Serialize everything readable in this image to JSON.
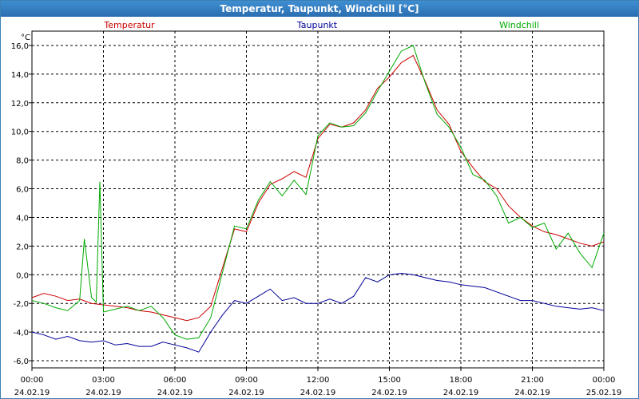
{
  "window": {
    "title": "Temperatur, Taupunkt, Windchill [°C]"
  },
  "chart_data": {
    "type": "line",
    "title": "Temperatur, Taupunkt, Windchill [°C]",
    "ylabel": "°C",
    "xlabel": "",
    "ylim": [
      -6.5,
      17.0
    ],
    "xlim": [
      0,
      24
    ],
    "grid": true,
    "legend_position": "top",
    "y_ticks": [
      "16,0",
      "14,0",
      "12,0",
      "10,0",
      "8,0",
      "6,0",
      "4,0",
      "2,0",
      "0,0",
      "-2,0",
      "-4,0",
      "-6,0"
    ],
    "x_ticks": [
      {
        "time": "00:00",
        "date": "24.02.19"
      },
      {
        "time": "03:00",
        "date": "24.02.19"
      },
      {
        "time": "06:00",
        "date": "24.02.19"
      },
      {
        "time": "09:00",
        "date": "24.02.19"
      },
      {
        "time": "12:00",
        "date": "24.02.19"
      },
      {
        "time": "15:00",
        "date": "24.02.19"
      },
      {
        "time": "18:00",
        "date": "24.02.19"
      },
      {
        "time": "21:00",
        "date": "24.02.19"
      },
      {
        "time": "00:00",
        "date": "25.02.19"
      }
    ],
    "series": [
      {
        "name": "Temperatur",
        "color": "#cc0000",
        "points": [
          [
            0,
            -1.6
          ],
          [
            0.5,
            -1.3
          ],
          [
            1,
            -1.5
          ],
          [
            1.5,
            -1.8
          ],
          [
            2,
            -1.7
          ],
          [
            2.5,
            -2.0
          ],
          [
            3,
            -2.1
          ],
          [
            3.5,
            -2.2
          ],
          [
            4,
            -2.3
          ],
          [
            4.5,
            -2.5
          ],
          [
            5,
            -2.6
          ],
          [
            5.5,
            -2.8
          ],
          [
            6,
            -3.0
          ],
          [
            6.5,
            -3.2
          ],
          [
            7,
            -3.0
          ],
          [
            7.5,
            -2.2
          ],
          [
            8,
            0.5
          ],
          [
            8.5,
            3.2
          ],
          [
            9,
            3.0
          ],
          [
            9.5,
            5.0
          ],
          [
            10,
            6.3
          ],
          [
            10.5,
            6.7
          ],
          [
            11,
            7.2
          ],
          [
            11.5,
            6.8
          ],
          [
            12,
            9.5
          ],
          [
            12.5,
            10.5
          ],
          [
            13,
            10.3
          ],
          [
            13.5,
            10.6
          ],
          [
            14,
            11.5
          ],
          [
            14.5,
            13.0
          ],
          [
            15,
            13.8
          ],
          [
            15.5,
            14.8
          ],
          [
            16,
            15.3
          ],
          [
            16.5,
            13.5
          ],
          [
            17,
            11.5
          ],
          [
            17.5,
            10.5
          ],
          [
            18,
            8.6
          ],
          [
            18.5,
            7.5
          ],
          [
            19,
            6.5
          ],
          [
            19.5,
            6.0
          ],
          [
            20,
            4.8
          ],
          [
            20.5,
            4.0
          ],
          [
            21,
            3.4
          ],
          [
            21.5,
            3.0
          ],
          [
            22,
            2.8
          ],
          [
            22.5,
            2.5
          ],
          [
            23,
            2.2
          ],
          [
            23.5,
            2.0
          ],
          [
            24,
            2.3
          ]
        ]
      },
      {
        "name": "Taupunkt",
        "color": "#000099",
        "points": [
          [
            0,
            -4.0
          ],
          [
            0.5,
            -4.2
          ],
          [
            1,
            -4.5
          ],
          [
            1.5,
            -4.3
          ],
          [
            2,
            -4.6
          ],
          [
            2.5,
            -4.7
          ],
          [
            3,
            -4.6
          ],
          [
            3.5,
            -4.9
          ],
          [
            4,
            -4.8
          ],
          [
            4.5,
            -5.0
          ],
          [
            5,
            -5.0
          ],
          [
            5.5,
            -4.7
          ],
          [
            6,
            -4.9
          ],
          [
            6.5,
            -5.1
          ],
          [
            7,
            -5.4
          ],
          [
            7.5,
            -4.0
          ],
          [
            8,
            -2.8
          ],
          [
            8.5,
            -1.8
          ],
          [
            9,
            -2.0
          ],
          [
            9.5,
            -1.5
          ],
          [
            10,
            -1.0
          ],
          [
            10.5,
            -1.8
          ],
          [
            11,
            -1.6
          ],
          [
            11.5,
            -2.0
          ],
          [
            12,
            -2.0
          ],
          [
            12.5,
            -1.7
          ],
          [
            13,
            -2.0
          ],
          [
            13.5,
            -1.5
          ],
          [
            14,
            -0.2
          ],
          [
            14.5,
            -0.5
          ],
          [
            15,
            0.0
          ],
          [
            15.5,
            0.1
          ],
          [
            16,
            0.0
          ],
          [
            16.5,
            -0.2
          ],
          [
            17,
            -0.4
          ],
          [
            17.5,
            -0.5
          ],
          [
            18,
            -0.7
          ],
          [
            18.5,
            -0.8
          ],
          [
            19,
            -0.9
          ],
          [
            19.5,
            -1.2
          ],
          [
            20,
            -1.5
          ],
          [
            20.5,
            -1.8
          ],
          [
            21,
            -1.8
          ],
          [
            21.5,
            -2.0
          ],
          [
            22,
            -2.2
          ],
          [
            22.5,
            -2.3
          ],
          [
            23,
            -2.4
          ],
          [
            23.5,
            -2.3
          ],
          [
            24,
            -2.5
          ]
        ]
      },
      {
        "name": "Windchill",
        "color": "#00aa00",
        "points": [
          [
            0,
            -1.8
          ],
          [
            0.5,
            -2.0
          ],
          [
            1,
            -2.3
          ],
          [
            1.5,
            -2.5
          ],
          [
            2,
            -1.8
          ],
          [
            2.2,
            2.5
          ],
          [
            2.5,
            -1.6
          ],
          [
            2.7,
            -1.9
          ],
          [
            2.85,
            6.5
          ],
          [
            3,
            -2.6
          ],
          [
            3.5,
            -2.4
          ],
          [
            4,
            -2.2
          ],
          [
            4.5,
            -2.5
          ],
          [
            5,
            -2.2
          ],
          [
            5.5,
            -3.0
          ],
          [
            6,
            -4.2
          ],
          [
            6.5,
            -4.5
          ],
          [
            7,
            -4.4
          ],
          [
            7.5,
            -3.0
          ],
          [
            8,
            0.2
          ],
          [
            8.5,
            3.4
          ],
          [
            9,
            3.2
          ],
          [
            9.5,
            5.2
          ],
          [
            10,
            6.5
          ],
          [
            10.5,
            5.5
          ],
          [
            11,
            6.6
          ],
          [
            11.5,
            5.6
          ],
          [
            12,
            9.7
          ],
          [
            12.5,
            10.6
          ],
          [
            13,
            10.3
          ],
          [
            13.5,
            10.4
          ],
          [
            14,
            11.3
          ],
          [
            14.5,
            12.8
          ],
          [
            15,
            14.2
          ],
          [
            15.5,
            15.6
          ],
          [
            16,
            16.0
          ],
          [
            16.5,
            13.4
          ],
          [
            17,
            11.2
          ],
          [
            17.5,
            10.3
          ],
          [
            18,
            8.9
          ],
          [
            18.5,
            7.0
          ],
          [
            19,
            6.6
          ],
          [
            19.5,
            5.5
          ],
          [
            20,
            3.6
          ],
          [
            20.5,
            4.0
          ],
          [
            21,
            3.3
          ],
          [
            21.5,
            3.6
          ],
          [
            22,
            1.8
          ],
          [
            22.5,
            2.9
          ],
          [
            23,
            1.5
          ],
          [
            23.5,
            0.5
          ],
          [
            24,
            2.9
          ]
        ]
      }
    ]
  }
}
